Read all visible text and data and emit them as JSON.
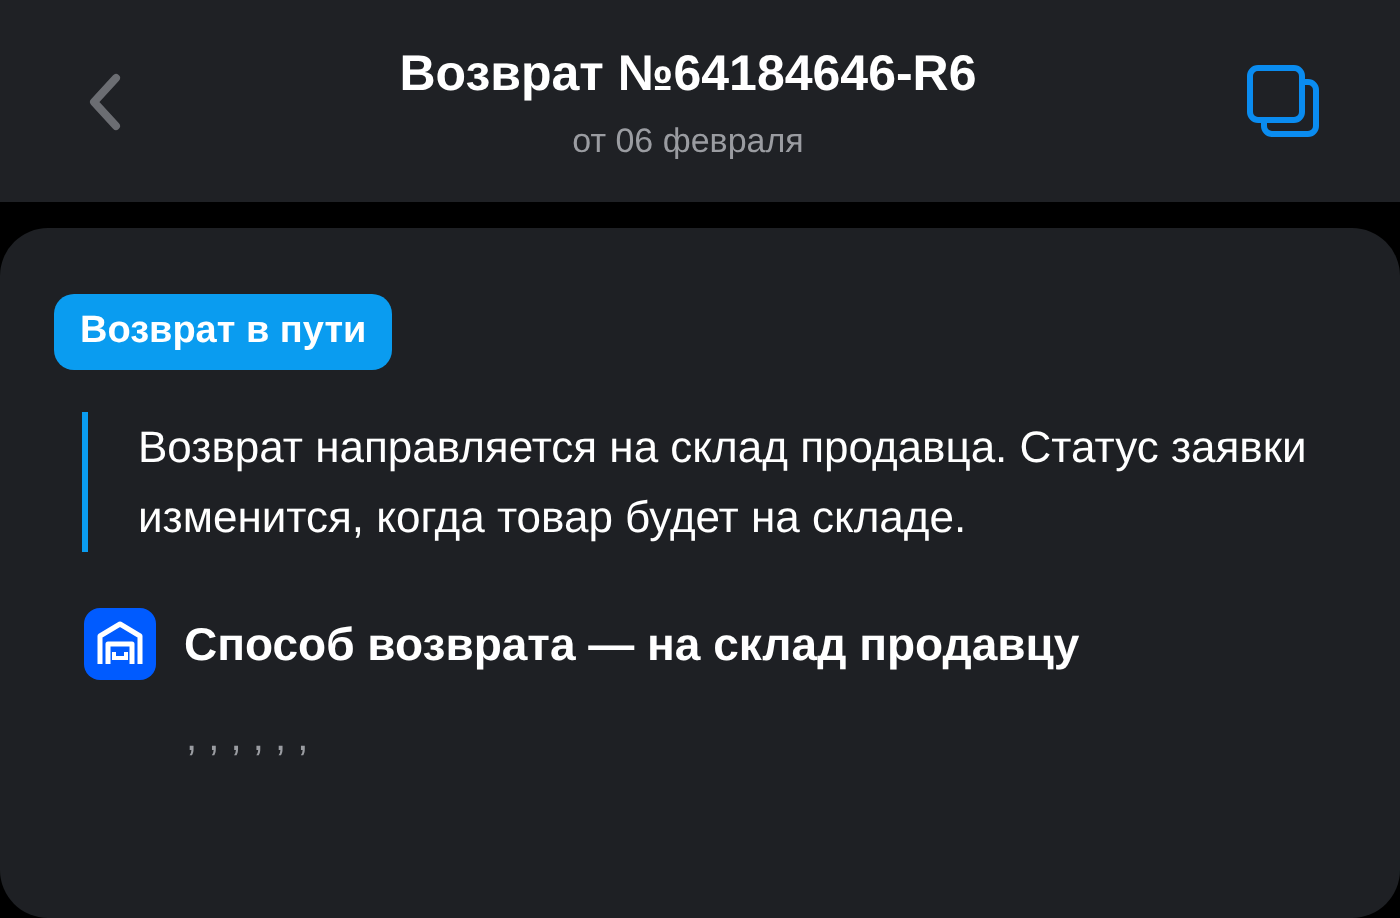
{
  "header": {
    "title": "Возврат №64184646-R6",
    "subtitle": "от 06 февраля"
  },
  "status": {
    "badge": "Возврат в пути",
    "message": "Возврат направляется на склад продавца. Статус заявки изменится, когда товар будет на складе."
  },
  "method": {
    "label": "Способ возврата — на склад продавцу",
    "address": ", , , , , ,"
  }
}
